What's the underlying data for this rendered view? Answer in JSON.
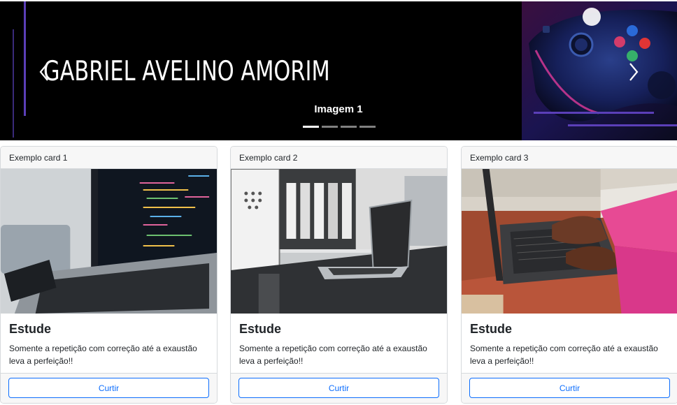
{
  "carousel": {
    "title": "GABRIEL AVELINO AMORIM",
    "caption": "Imagem 1",
    "indicator_count": 4,
    "active_index": 0,
    "accent_color": "#5b3fb8"
  },
  "cards": [
    {
      "header": "Exemplo card 1",
      "title": "Estude",
      "text": "Somente a repetição com correção até a exaustão leva a perfeição!!",
      "button": "Curtir"
    },
    {
      "header": "Exemplo card 2",
      "title": "Estude",
      "text": "Somente a repetição com correção até a exaustão leva a perfeição!!",
      "button": "Curtir"
    },
    {
      "header": "Exemplo card 3",
      "title": "Estude",
      "text": "Somente a repetição com correção até a exaustão leva a perfeição!!",
      "button": "Curtir"
    }
  ],
  "colors": {
    "button": "#0d6efd",
    "card_border": "#d6d9dc",
    "card_header_bg": "#f7f7f7"
  }
}
